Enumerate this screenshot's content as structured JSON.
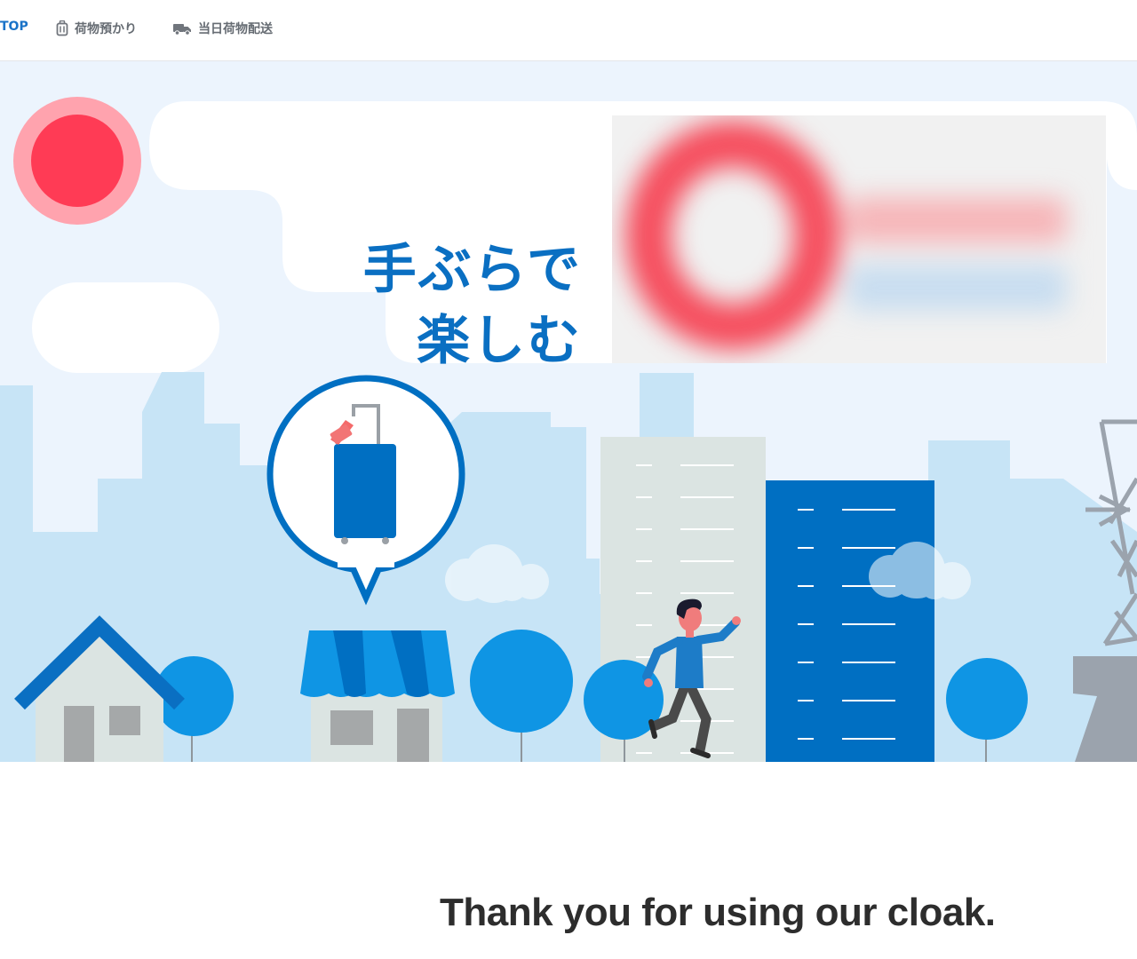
{
  "nav": {
    "items": [
      {
        "label": "TOP",
        "icon": "none",
        "active": true
      },
      {
        "label": "荷物預かり",
        "icon": "luggage-icon",
        "active": false
      },
      {
        "label": "当日荷物配送",
        "icon": "truck-icon",
        "active": false
      }
    ]
  },
  "hero": {
    "tagline_line1": "手ぶらで",
    "tagline_line2": "楽しむ",
    "logo_state": "blurred",
    "colors": {
      "brand_blue": "#0a6fc2",
      "sky": "#ecf4fd",
      "building_light": "#c7e4f6",
      "sun": "#ff3b55",
      "sun_halo": "#ffa3ae",
      "tree": "#0f95e4"
    }
  },
  "message": {
    "thank_you": "Thank you for using our cloak."
  }
}
